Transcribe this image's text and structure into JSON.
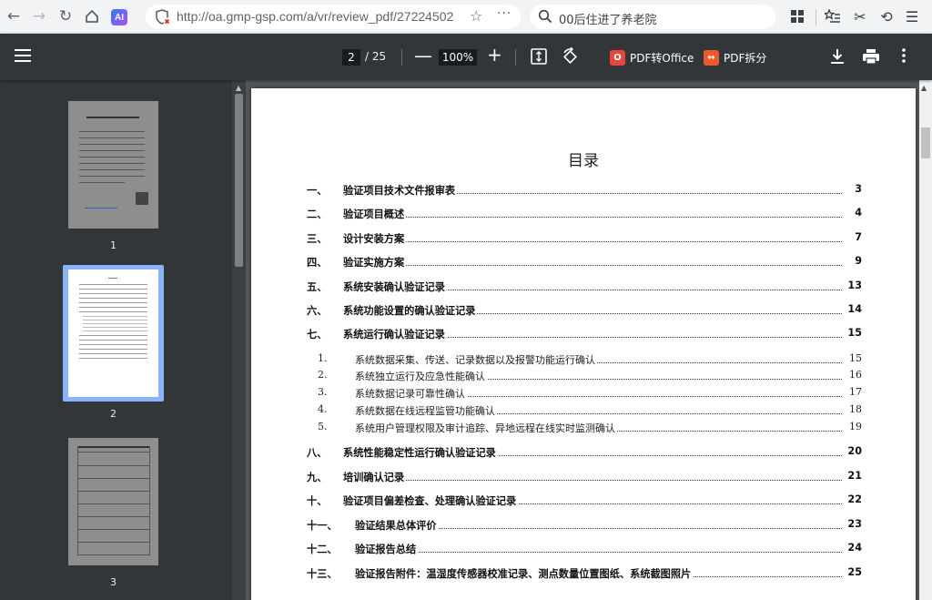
{
  "browser": {
    "url": "http://oa.gmp-gsp.com/a/vr/review_pdf/27224502",
    "search_text": "00后住进了养老院",
    "ai_label": "AI",
    "more": "···"
  },
  "pdf_toolbar": {
    "current_page": "2",
    "total_pages": "/ 25",
    "zoom": "100%",
    "to_office": "PDF转Office",
    "split": "PDF拆分",
    "colors": {
      "to_office": "#e8453c",
      "split": "#f05a28"
    }
  },
  "sidebar": {
    "thumbnails": [
      {
        "label": "1"
      },
      {
        "label": "2"
      },
      {
        "label": "3"
      }
    ]
  },
  "document": {
    "title": "目录",
    "toc": [
      {
        "num": "一、",
        "title": "验证项目技术文件报审表",
        "page": "3",
        "bold": true
      },
      {
        "num": "二、",
        "title": "验证项目概述",
        "page": "4",
        "bold": true
      },
      {
        "num": "三、",
        "title": "设计安装方案",
        "page": "7",
        "bold": true
      },
      {
        "num": "四、",
        "title": "验证实施方案",
        "page": "9",
        "bold": true
      },
      {
        "num": "五、",
        "title": "系统安装确认验证记录",
        "page": "13",
        "bold": true
      },
      {
        "num": "六、",
        "title": "系统功能设置的确认验证记录",
        "page": "14",
        "bold": true
      },
      {
        "num": "七、",
        "title": "系统运行确认验证记录",
        "page": "15",
        "bold": true
      },
      {
        "num": "1.",
        "title": "系统数据采集、传送、记录数据以及报警功能运行确认",
        "page": "15",
        "bold": false
      },
      {
        "num": "2.",
        "title": "系统独立运行及应急性能确认",
        "page": "16",
        "bold": false
      },
      {
        "num": "3.",
        "title": "系统数据记录可靠性确认",
        "page": "17",
        "bold": false
      },
      {
        "num": "4.",
        "title": "系统数据在线远程监管功能确认",
        "page": "18",
        "bold": false
      },
      {
        "num": "5.",
        "title": "系统用户管理权限及审计追踪、异地远程在线实时监测确认",
        "page": "19",
        "bold": false
      },
      {
        "num": "八、",
        "title": "系统性能稳定性运行确认验证记录",
        "page": "20",
        "bold": true
      },
      {
        "num": "九、",
        "title": "培训确认记录",
        "page": "21",
        "bold": true
      },
      {
        "num": "十、",
        "title": "验证项目偏差检查、处理确认验证记录",
        "page": "22",
        "bold": true
      },
      {
        "num": "十一、",
        "title": "验证结果总体评价",
        "page": "23",
        "bold": true
      },
      {
        "num": "十二、",
        "title": "验证报告总结",
        "page": "24",
        "bold": true
      },
      {
        "num": "十三、",
        "title": "验证报告附件：温湿度传感器校准记录、测点数量位置图纸、系统截图照片",
        "page": "25",
        "bold": true
      }
    ]
  }
}
